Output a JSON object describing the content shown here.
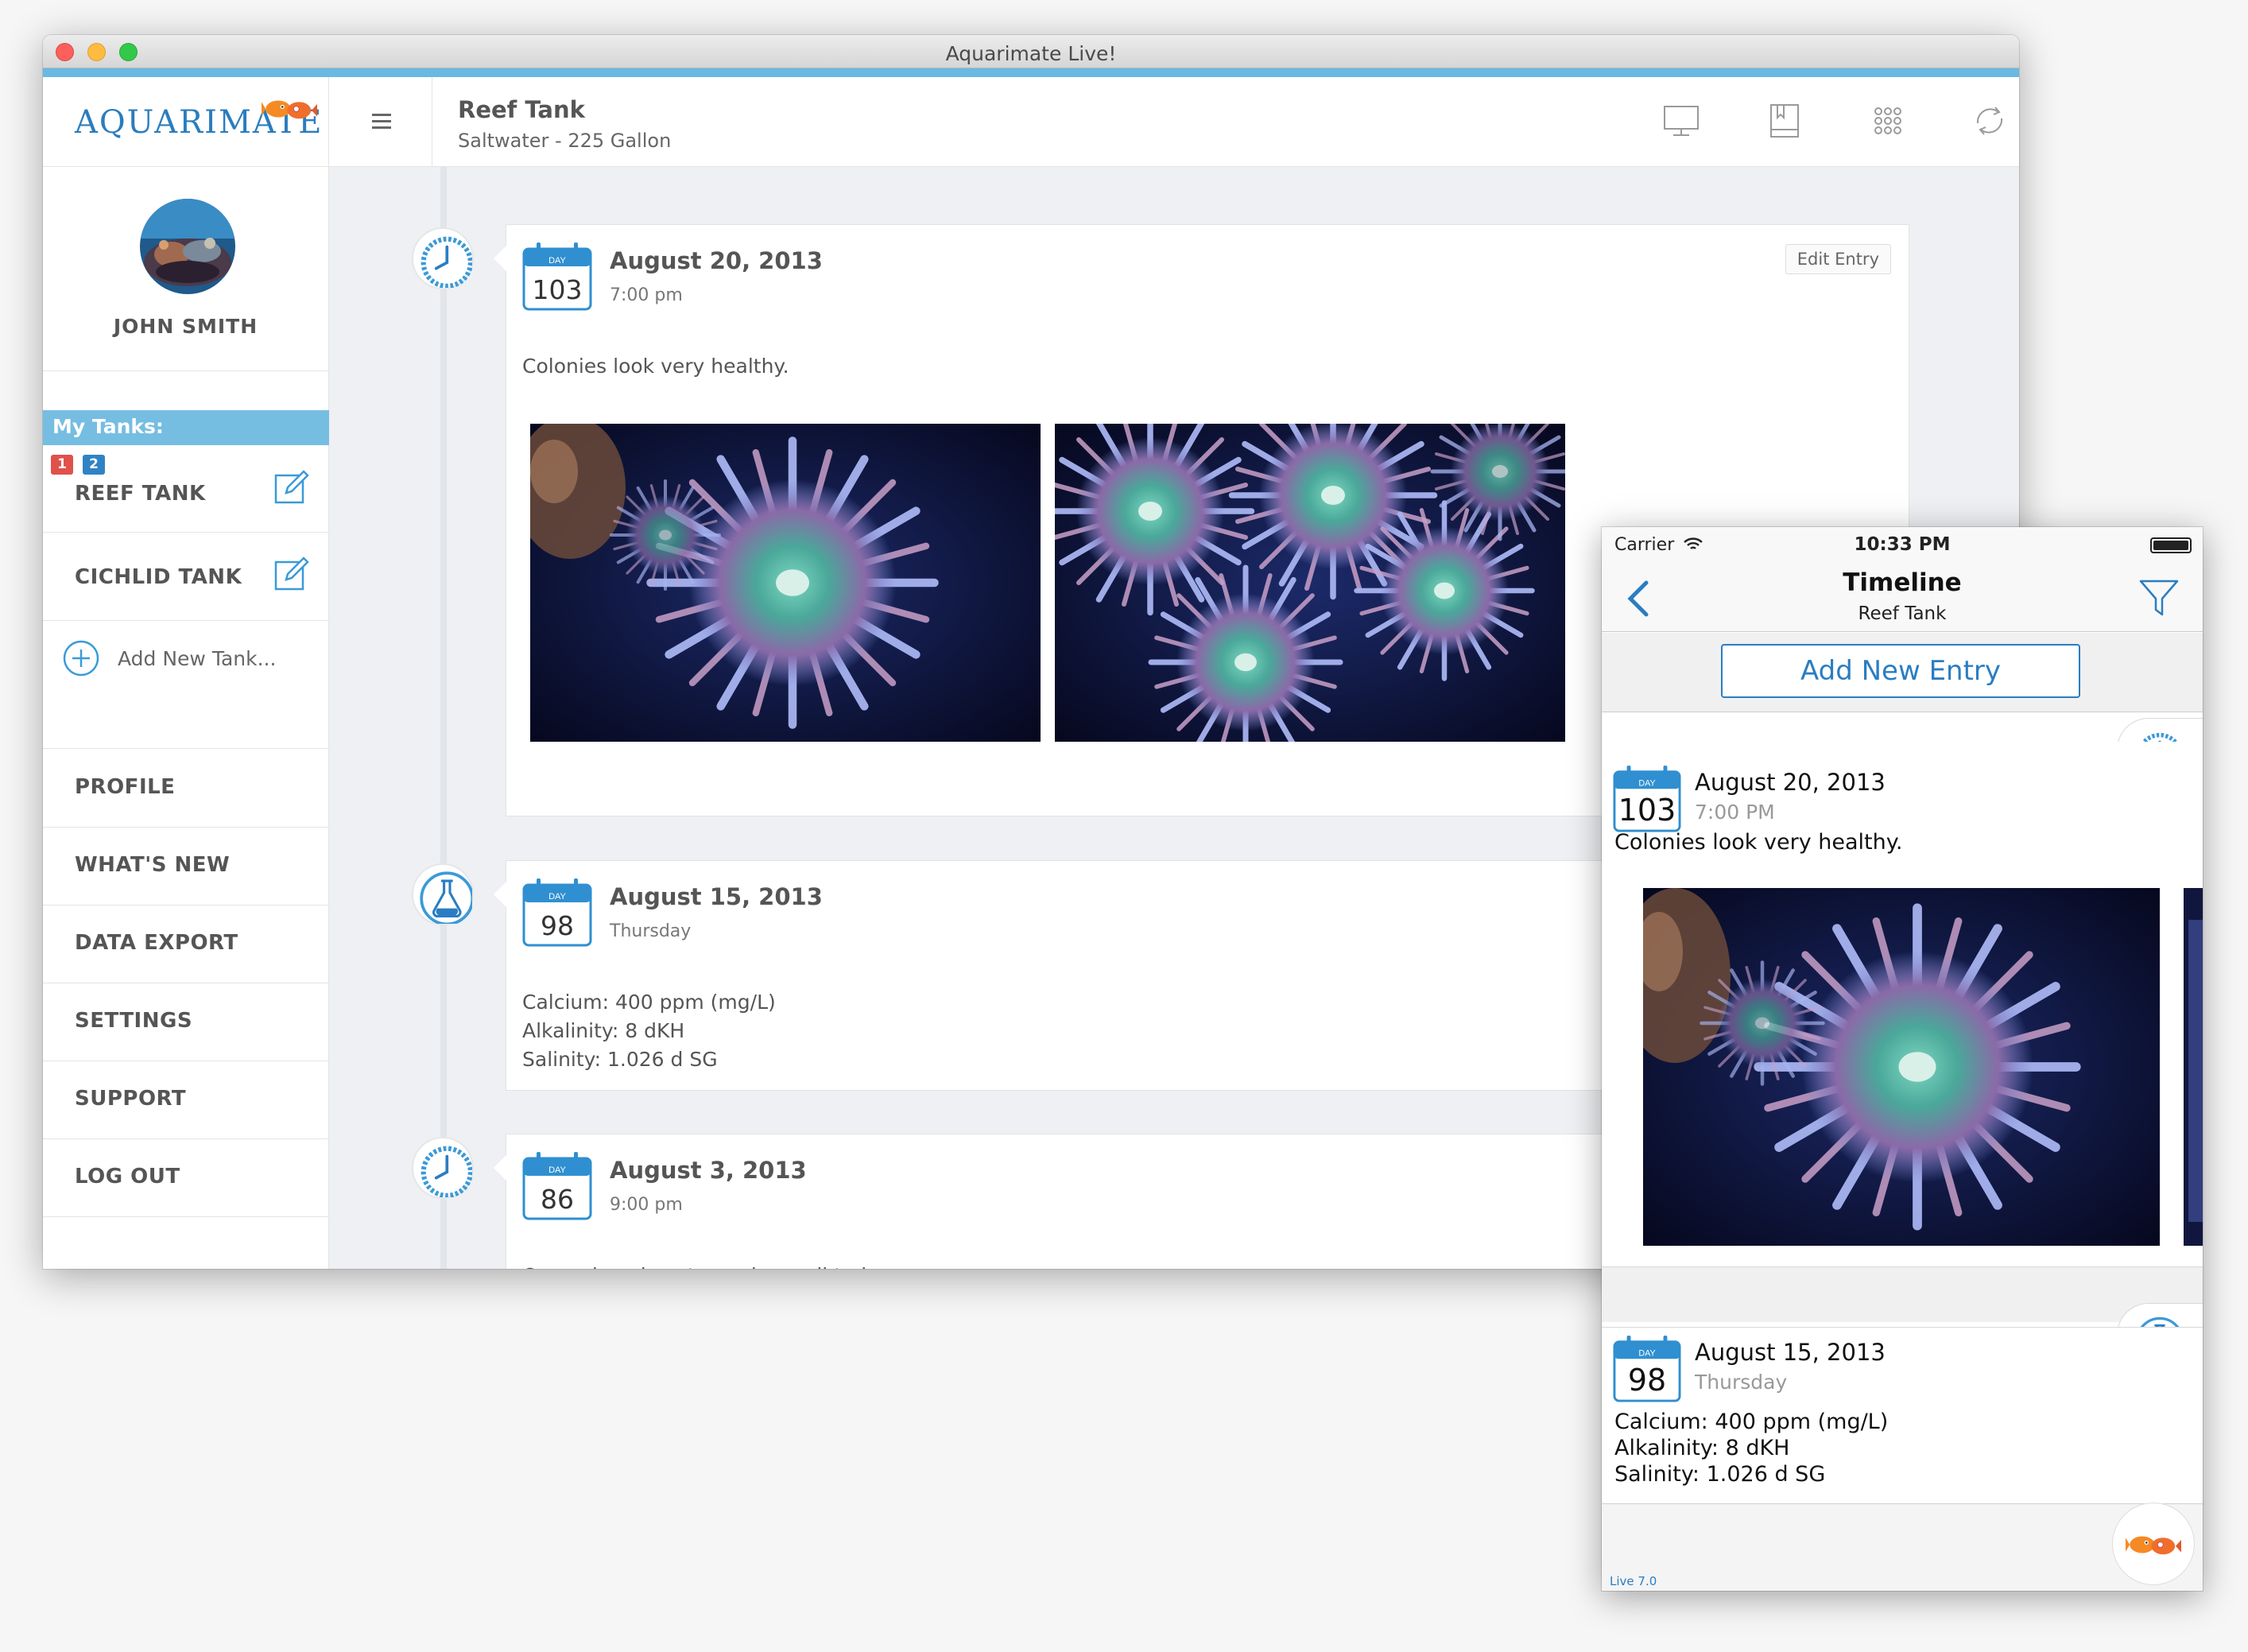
{
  "window": {
    "title": "Aquarimate Live!"
  },
  "sidebar": {
    "logo": "Aquarimate",
    "user_name": "JOHN SMITH",
    "my_tanks_label": "My Tanks:",
    "tanks": [
      {
        "label": "REEF TANK",
        "badges": [
          "1",
          "2"
        ]
      },
      {
        "label": "CICHLID TANK"
      }
    ],
    "add_tank_label": "Add New Tank...",
    "menu": [
      "PROFILE",
      "WHAT'S NEW",
      "DATA EXPORT",
      "SETTINGS",
      "SUPPORT",
      "LOG OUT"
    ]
  },
  "header": {
    "tank_name": "Reef Tank",
    "tank_info": "Saltwater - 225 Gallon",
    "icons": [
      "monitor-icon",
      "book-icon",
      "grid-icon",
      "sync-icon"
    ]
  },
  "timeline": {
    "day_label": "DAY",
    "edit_label": "Edit Entry",
    "entries": [
      {
        "day": "103",
        "date": "August 20, 2013",
        "sub": "7:00 pm",
        "type": "clock",
        "body": "Colonies look very healthy."
      },
      {
        "day": "98",
        "date": "August 15, 2013",
        "sub": "Thursday",
        "type": "flask",
        "lines": [
          "Calcium: 400 ppm (mg/L)",
          "Alkalinity: 8 dKH",
          "Salinity: 1.026 d SG"
        ]
      },
      {
        "day": "86",
        "date": "August 3, 2013",
        "sub": "9:00 pm",
        "type": "clock",
        "body": "One colony is not opening well today.."
      }
    ]
  },
  "phone": {
    "carrier": "Carrier",
    "time": "10:33 PM",
    "nav_title": "Timeline",
    "nav_subtitle": "Reef Tank",
    "add_entry": "Add New Entry",
    "entries": [
      {
        "day": "103",
        "date": "August 20, 2013",
        "sub": "7:00 PM",
        "body": "Colonies look very healthy."
      },
      {
        "day": "98",
        "date": "August 15, 2013",
        "sub": "Thursday",
        "lines": [
          "Calcium: 400 ppm (mg/L)",
          "Alkalinity: 8 dKH",
          "Salinity: 1.026 d SG"
        ]
      }
    ],
    "version": "Live 7.0"
  },
  "colors": {
    "accent": "#2a7dc2",
    "sidebar_highlight": "#76bde2",
    "badge_red": "#e0514b",
    "badge_blue": "#2f83c5"
  }
}
